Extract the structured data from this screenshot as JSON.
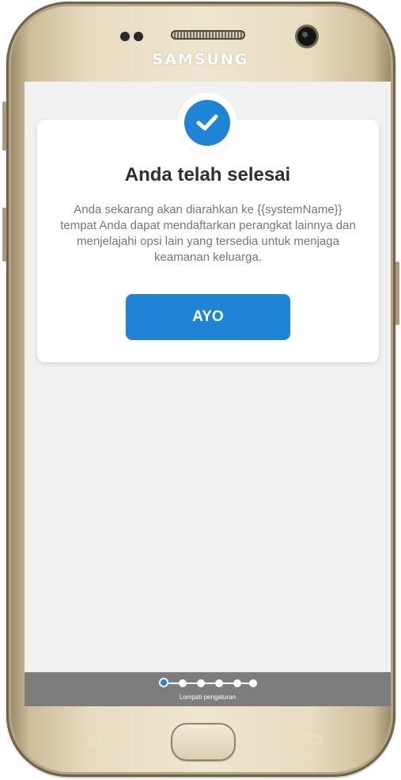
{
  "device": {
    "brand": "SAMSUNG"
  },
  "card": {
    "title": "Anda telah selesai",
    "message": "Anda sekarang akan diarahkan ke {{systemName}} tempat Anda dapat mendaftarkan perangkat lainnya dan menjelajahi opsi lain yang tersedia untuk menjaga keamanan keluarga.",
    "button_label": "AYO",
    "icon": "check-icon"
  },
  "progress": {
    "total_steps": 6,
    "current_step": 1,
    "skip_label": "Lompati pengaturan"
  },
  "colors": {
    "accent": "#1f84d6",
    "screen_bg": "#f1f1f1",
    "progress_bar_bg": "#7d7d7d"
  }
}
